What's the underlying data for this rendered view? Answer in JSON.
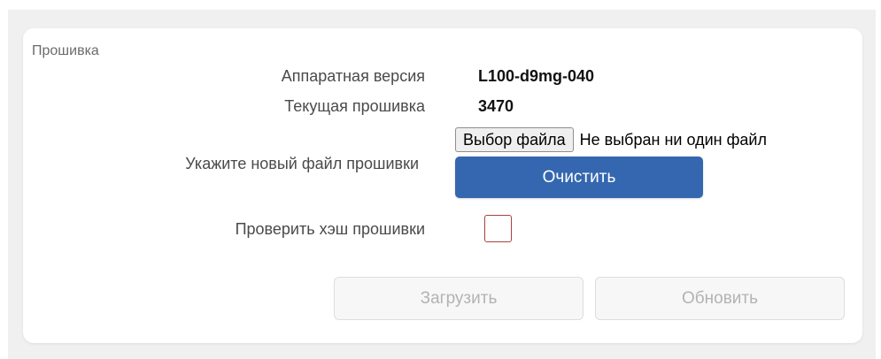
{
  "header_fragment": "",
  "section": {
    "title": "Прошивка"
  },
  "fields": {
    "hardware_label": "Аппаратная версия",
    "hardware_value": "L100-d9mg-040",
    "firmware_label": "Текущая прошивка",
    "firmware_value": "3470",
    "new_file_label": "Укажите новый файл прошивки",
    "file_button_label": "Выбор файла",
    "file_status": "Не выбран ни один файл",
    "clear_label": "Очистить",
    "hash_label": "Проверить хэш прошивки",
    "hash_checked": false
  },
  "actions": {
    "upload_label": "Загрузить",
    "update_label": "Обновить",
    "upload_disabled": true,
    "update_disabled": true
  },
  "colors": {
    "primary": "#3467b0",
    "checkbox_border": "#a8403f",
    "disabled_text": "#b3b3b3",
    "page_background": "#f0f0f0"
  }
}
